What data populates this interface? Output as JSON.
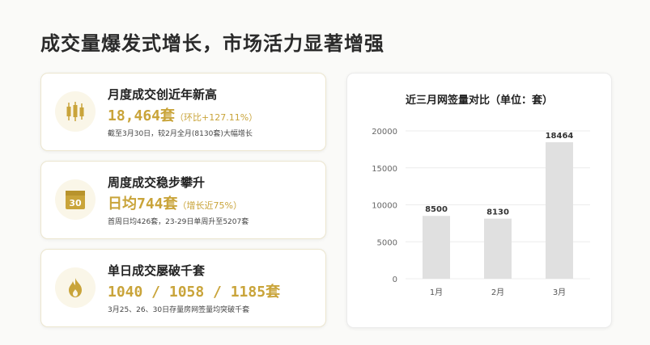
{
  "page": {
    "title": "成交量爆发式增长，市场活力显著增强"
  },
  "cards": [
    {
      "title": "月度成交创近年新高",
      "value": "18,464套",
      "value_sub": "（环比+127.11%）",
      "note": "截至3月30日，较2月全月(8130套)大幅增长",
      "icon": "candlestick-chart-icon"
    },
    {
      "title": "周度成交稳步攀升",
      "value": "日均744套",
      "value_sub": "（增长近75%）",
      "note": "首周日均426套，23-29日单周升至5207套",
      "icon": "calendar-30-icon",
      "icon_text": "30"
    },
    {
      "title": "单日成交屡破千套",
      "value": "1040 / 1058 / 1185套",
      "value_sub": "",
      "note": "3月25、26、30日存量房网签量均突破千套",
      "icon": "flame-icon"
    }
  ],
  "colors": {
    "accent": "#c9a43a",
    "bar": "#e0e0e0",
    "grid": "#ececec"
  },
  "chart_data": {
    "type": "bar",
    "title": "近三月网签量对比（单位：套）",
    "categories": [
      "1月",
      "2月",
      "3月"
    ],
    "values": [
      8500,
      8130,
      18464
    ],
    "ylim": [
      0,
      20000
    ],
    "yticks": [
      0,
      5000,
      10000,
      15000,
      20000
    ],
    "grid": true,
    "legend": "none",
    "xlabel": "",
    "ylabel": ""
  }
}
